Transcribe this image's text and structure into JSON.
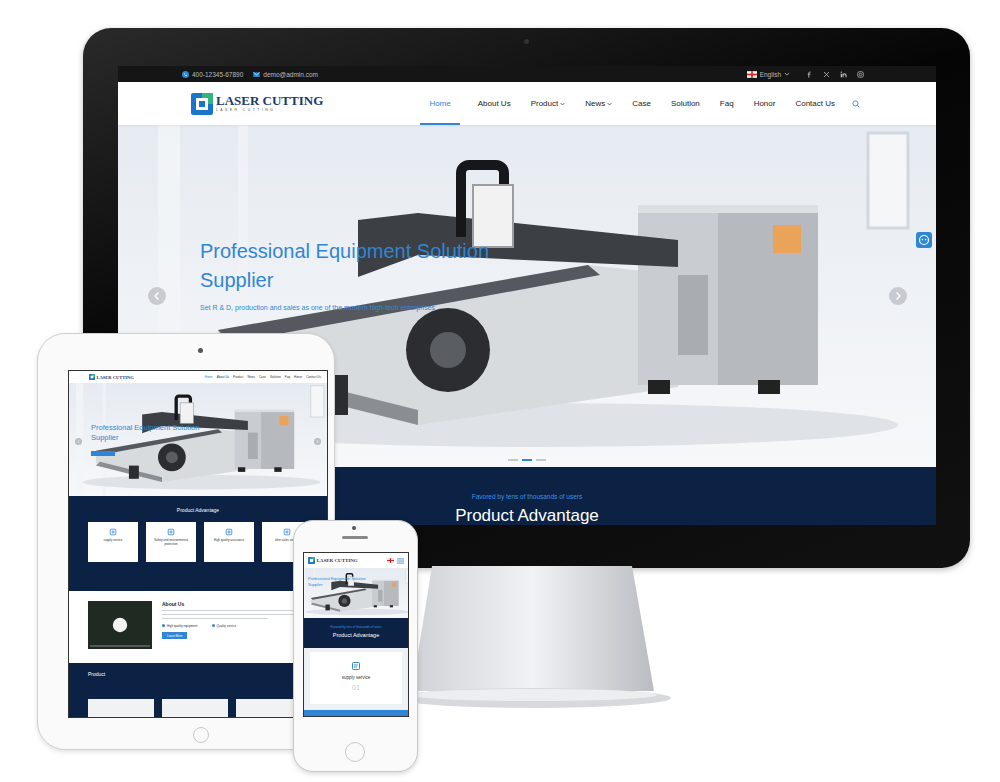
{
  "desktop": {
    "topbar": {
      "phone": "400-12345-67890",
      "email": "demo@admin.com",
      "language": "English"
    },
    "logo": {
      "title": "LASER CUTTING",
      "subtitle": "LASER CUTTING"
    },
    "nav": [
      {
        "label": "Home",
        "selected": true,
        "dropdown": false
      },
      {
        "label": "About Us",
        "selected": false,
        "dropdown": false
      },
      {
        "label": "Product",
        "selected": false,
        "dropdown": true
      },
      {
        "label": "News",
        "selected": false,
        "dropdown": true
      },
      {
        "label": "Case",
        "selected": false,
        "dropdown": false
      },
      {
        "label": "Solution",
        "selected": false,
        "dropdown": false
      },
      {
        "label": "Faq",
        "selected": false,
        "dropdown": false
      },
      {
        "label": "Honor",
        "selected": false,
        "dropdown": false
      },
      {
        "label": "Contact Us",
        "selected": false,
        "dropdown": false
      }
    ],
    "hero": {
      "title": "Professional Equipment Solution Supplier",
      "subtitle": "Set R & D, production and sales as one of the modern high-tech enterprises",
      "dots": [
        {
          "selected": false
        },
        {
          "selected": true
        },
        {
          "selected": false
        }
      ]
    },
    "band": {
      "eyebrow": "Favored by tens of thousands of users",
      "title": "Product Advantage"
    }
  },
  "tablet": {
    "logo": "LASER CUTTING",
    "nav": [
      {
        "label": "Home",
        "selected": true
      },
      {
        "label": "About Us",
        "selected": false
      },
      {
        "label": "Product",
        "selected": false
      },
      {
        "label": "News",
        "selected": false
      },
      {
        "label": "Case",
        "selected": false
      },
      {
        "label": "Solution",
        "selected": false
      },
      {
        "label": "Faq",
        "selected": false
      },
      {
        "label": "Honor",
        "selected": false
      },
      {
        "label": "Contact Us",
        "selected": false
      }
    ],
    "hero": {
      "title": "Professional Equipment Solution Supplier"
    },
    "advantage": {
      "title": "Product Advantage",
      "cards": [
        {
          "label": "supply service"
        },
        {
          "label": "Safety and environmental protection"
        },
        {
          "label": "High quality assurance"
        },
        {
          "label": "after-sales service"
        }
      ]
    },
    "about": {
      "title": "About Us",
      "features": [
        "High quality equipment",
        "Quality service"
      ],
      "button": "Learn More"
    },
    "product": {
      "title": "Product"
    }
  },
  "phone": {
    "logo": "LASER CUTTING",
    "hero": {
      "title": "Professional Equipment Solution Supplier"
    },
    "band": {
      "eyebrow": "Favored by tens of thousands of users",
      "title": "Product Advantage"
    },
    "card": {
      "label": "supply service",
      "number": "01"
    }
  }
}
